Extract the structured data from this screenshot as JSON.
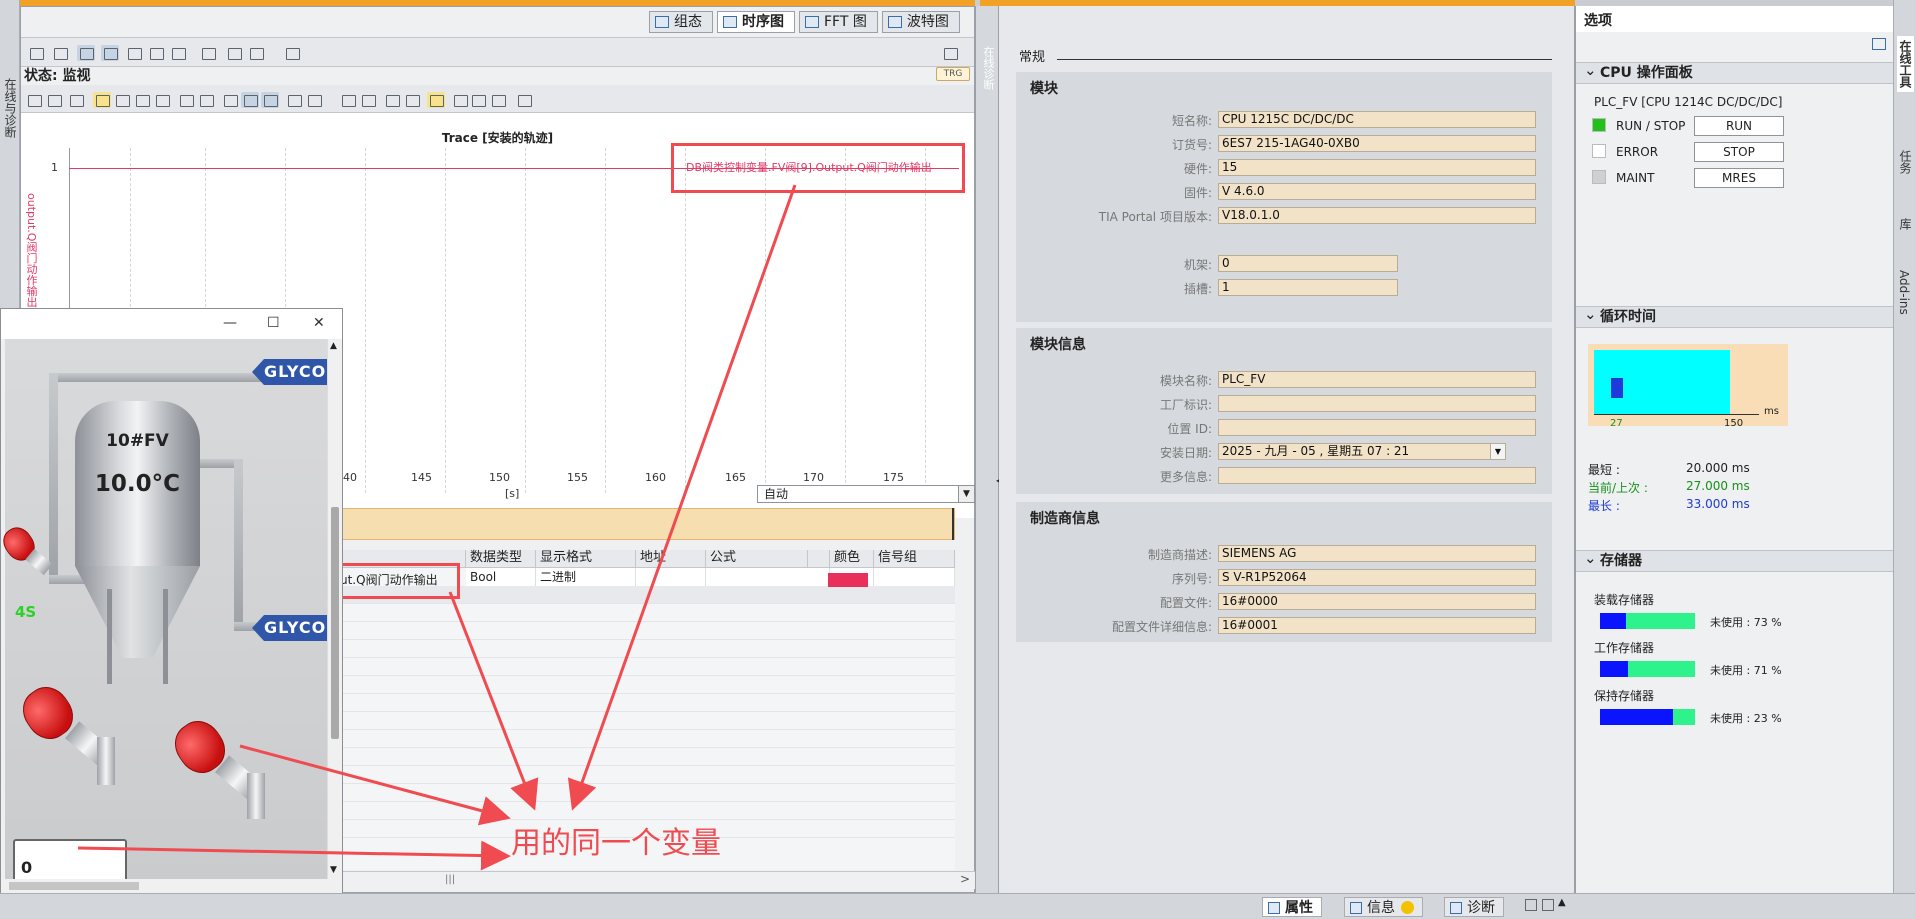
{
  "editor": {
    "view_tabs": [
      "组态",
      "时序图",
      "FFT 图",
      "波特图"
    ],
    "active_tab": "时序图",
    "status": "状态: 监视",
    "trg_badge": "TRG"
  },
  "left_sidebar": {
    "label": "在线与诊断"
  },
  "chart": {
    "title": "Trace [安装的轨迹]",
    "y_tick": "1",
    "y_axis_label": "output.Q阀门动作输出",
    "signal_legend": "DB阀类控制变量.FV阀[9].Output.Q阀门动作输出",
    "x_ticks": [
      "40",
      "145",
      "150",
      "155",
      "160",
      "165",
      "170",
      "175"
    ],
    "x_unit": "[s]",
    "zoom_mode": "自动"
  },
  "signal_table": {
    "headers": [
      "数据类型",
      "显示格式",
      "地址",
      "公式",
      "颜色",
      "信号组"
    ],
    "row": {
      "name": "ut.Q阀门动作输出",
      "type": "Bool",
      "format": "二进制",
      "color": "#e8305a"
    }
  },
  "hmi": {
    "tank_name": "10#FV",
    "tank_temp": "10.0°C",
    "glycol_top": "GLYCOL",
    "glycol_bottom": "GLYCOL",
    "timer": "4S",
    "value": "0"
  },
  "annotation": {
    "text": "用的同一个变量",
    "color": "#ef4b50"
  },
  "splitter_label": "在线诊断",
  "properties": {
    "general_tab": "常规",
    "module": {
      "title": "模块",
      "fields": [
        {
          "label": "短名称:",
          "value": "CPU 1215C DC/DC/DC"
        },
        {
          "label": "订货号:",
          "value": "6ES7 215-1AG40-0XB0"
        },
        {
          "label": "硬件:",
          "value": "15"
        },
        {
          "label": "固件:",
          "value": "V 4.6.0"
        },
        {
          "label": "TIA Portal 项目版本:",
          "value": "V18.0.1.0"
        },
        {
          "label": "机架:",
          "value": "0"
        },
        {
          "label": "插槽:",
          "value": "1"
        }
      ]
    },
    "module_info": {
      "title": "模块信息",
      "fields": [
        {
          "label": "模块名称:",
          "value": "PLC_FV"
        },
        {
          "label": "工厂标识:",
          "value": ""
        },
        {
          "label": "位置 ID:",
          "value": ""
        },
        {
          "label": "安装日期:",
          "value": "2025 - 九月 - 05 , 星期五    07 : 21"
        },
        {
          "label": "更多信息:",
          "value": ""
        }
      ]
    },
    "manufacturer": {
      "title": "制造商信息",
      "fields": [
        {
          "label": "制造商描述:",
          "value": "SIEMENS AG"
        },
        {
          "label": "序列号:",
          "value": "S V-R1P52064"
        },
        {
          "label": "配置文件:",
          "value": "16#0000"
        },
        {
          "label": "配置文件详细信息:",
          "value": "16#0001"
        }
      ]
    }
  },
  "tasks": {
    "header": "选项",
    "cpu_panel": {
      "title": "CPU 操作面板",
      "device": "PLC_FV [CPU 1214C DC/DC/DC]",
      "rows": [
        {
          "label": "RUN / STOP",
          "led": "#22c11a",
          "button": "RUN"
        },
        {
          "label": "ERROR",
          "led": "#ffffff",
          "button": "STOP"
        },
        {
          "label": "MAINT",
          "led": "#d0d0d0",
          "button": "MRES"
        }
      ]
    },
    "cycle": {
      "title": "循环时间",
      "axis_labels": [
        "27",
        "150"
      ],
      "unit": "ms",
      "stats": [
        {
          "label": "最短 :",
          "value": "20.000 ms",
          "color": "#222222"
        },
        {
          "label": "当前/上次 :",
          "value": "27.000 ms",
          "color": "#1a8f1a"
        },
        {
          "label": "最长 :",
          "value": "33.000 ms",
          "color": "#1f3ad1"
        }
      ]
    },
    "memory": {
      "title": "存储器",
      "items": [
        {
          "label": "装载存储器",
          "free": "未使用 : 73 %",
          "used_fraction": 0.27
        },
        {
          "label": "工作存储器",
          "free": "未使用 : 71 %",
          "used_fraction": 0.29
        },
        {
          "label": "保持存储器",
          "free": "未使用 : 23 %",
          "used_fraction": 0.77
        }
      ]
    }
  },
  "right_rail": [
    "在线工具",
    "任务",
    "库",
    "Add-ins"
  ],
  "statusbar": {
    "tabs": [
      "属性",
      "信息",
      "诊断"
    ]
  }
}
